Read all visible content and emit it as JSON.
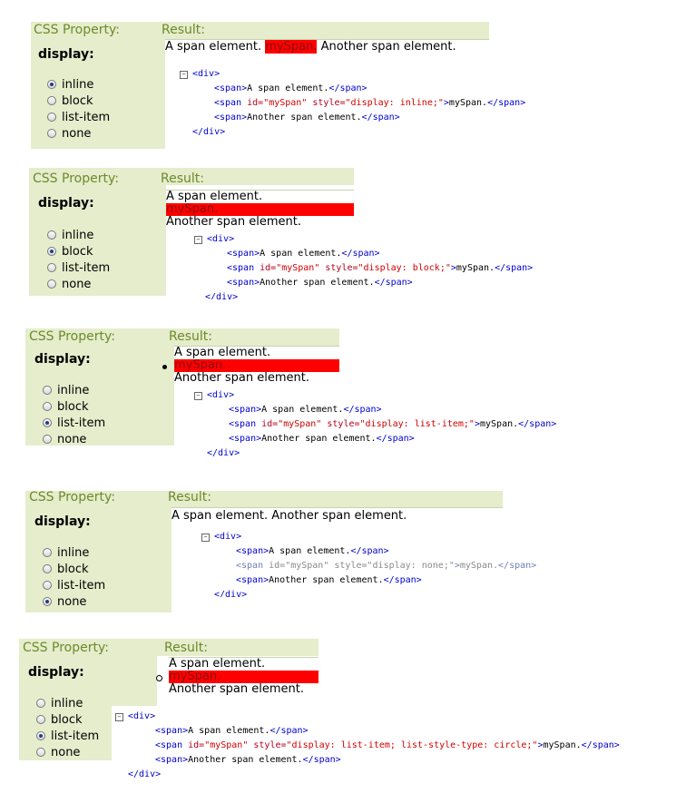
{
  "labels": {
    "css_property": "CSS Property:",
    "result": "Result:",
    "display": "display:"
  },
  "options": [
    "inline",
    "block",
    "list-item",
    "none"
  ],
  "text": {
    "span_a": "A span element.",
    "my_span": "mySpan.",
    "span_b": "Another span element."
  },
  "code": {
    "div_open": "<div>",
    "div_close": "</div>",
    "span_open": "<span>",
    "span_close": "</span>",
    "span_id_open": "<span ",
    "id_attr": "id=",
    "id_val": "\"mySpan\"",
    "style_attr": "style=",
    "gt": ">",
    "a_text": "A span element.",
    "b_text": "Another span element.",
    "my_text": "mySpan.",
    "toggle": "−"
  },
  "examples": [
    {
      "selected": "inline",
      "style_value": "\"display: inline;\""
    },
    {
      "selected": "block",
      "style_value": "\"display: block;\""
    },
    {
      "selected": "list-item",
      "style_value": "\"display: list-item;\""
    },
    {
      "selected": "none",
      "style_value": "\"display: none;\""
    },
    {
      "selected": "list-item",
      "style_value": "\"display: list-item; list-style-type: circle;\""
    }
  ],
  "colors": {
    "panel_bg": "#e5edcc",
    "header_text": "#6d8a2a",
    "highlight": "#ff0000",
    "tag": "#0000cc",
    "attr_value": "#d00000"
  }
}
